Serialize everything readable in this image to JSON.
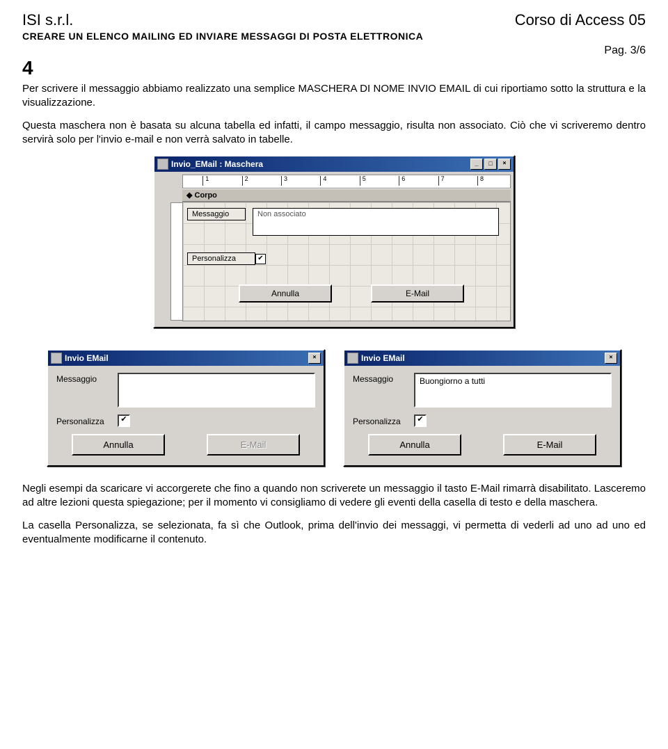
{
  "header": {
    "left": "ISI s.r.l.",
    "right": "Corso di Access 05",
    "subtitle": "CREARE UN ELENCO MAILING ED INVIARE MESSAGGI DI POSTA ELETTRONICA",
    "page": "Pag. 3/6",
    "section_number": "4"
  },
  "paragraphs": {
    "p1": "Per scrivere il messaggio abbiamo realizzato una semplice MASCHERA DI NOME INVIO EMAIL di cui riportiamo sotto la struttura e la visualizzazione.",
    "p2": "Questa maschera non è basata su alcuna tabella ed infatti, il campo messaggio, risulta non associato. Ciò che vi scriveremo dentro servirà solo per l'invio e-mail e non verrà salvato in tabelle.",
    "p3": "Negli esempi da scaricare vi accorgerete che fino a quando non scriverete un messaggio il tasto E-Mail rimarrà disabilitato. Lasceremo ad altre lezioni questa spiegazione; per il momento vi consigliamo di vedere gli eventi della casella di testo e della maschera.",
    "p4": "La casella Personalizza, se selezionata, fa sì che Outlook, prima dell'invio dei messaggi, vi permetta di vederli ad uno ad uno ed eventualmente modificarne il contenuto."
  },
  "design_window": {
    "title": "Invio_EMail : Maschera",
    "section_label": "Corpo",
    "labels": {
      "messaggio": "Messaggio",
      "personalizza": "Personalizza"
    },
    "field_placeholder": "Non associato",
    "buttons": {
      "annulla": "Annulla",
      "email": "E-Mail"
    },
    "ruler_ticks": [
      "1",
      "2",
      "3",
      "4",
      "5",
      "6",
      "7",
      "8"
    ]
  },
  "form_view": {
    "title": "Invio EMail",
    "labels": {
      "messaggio": "Messaggio",
      "personalizza": "Personalizza"
    },
    "message_value_filled": "Buongiorno a tutti",
    "check_mark": "✔",
    "buttons": {
      "annulla": "Annulla",
      "email_disabled": "E-Mail",
      "email": "E-Mail"
    }
  }
}
